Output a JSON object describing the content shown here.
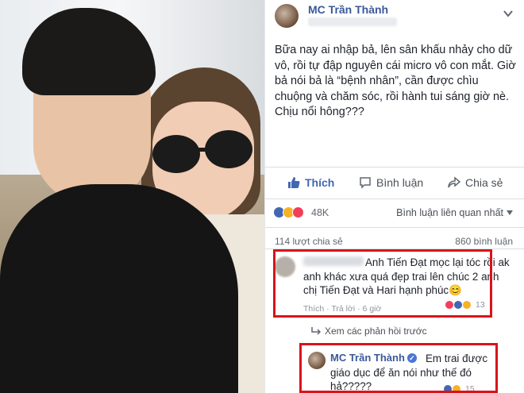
{
  "post": {
    "author": "MC Trần Thành",
    "text": "Bữa nay ai nhập bả, lên sân khấu nhảy cho dữ vô, rồi tự đập nguyên cái micro vô con mắt. Giờ bả nói bả là “bệnh nhân”, cần được chìu chuộng và chăm sóc, rồi hành tui sáng giờ nè. Chịu nổi hông???"
  },
  "actions": {
    "like": "Thích",
    "comment": "Bình luận",
    "share": "Chia sẻ"
  },
  "stats": {
    "reactions": "48K",
    "sort": "Bình luận liên quan nhất",
    "shares": "114 lượt chia sẻ",
    "comments": "860 bình luận"
  },
  "comment1": {
    "text": "Anh Tiến Đạt mọc lại tóc rồi ak anh khác xưa quá đẹp trai lên chúc 2 anh chị Tiến Đạt và Hari hạnh phúc😊",
    "meta": "Thích · Trả lời · 6 giờ",
    "reaction_count": "13"
  },
  "view_previous": "Xem các phản hồi trước",
  "comment2": {
    "author": "MC Trần Thành",
    "text": "Em trai được giáo dục để ăn nói như thế đó hả?????",
    "reaction_count": "15"
  },
  "colors": {
    "facebook_blue": "#3b5998",
    "highlight_red": "#d8141a"
  }
}
